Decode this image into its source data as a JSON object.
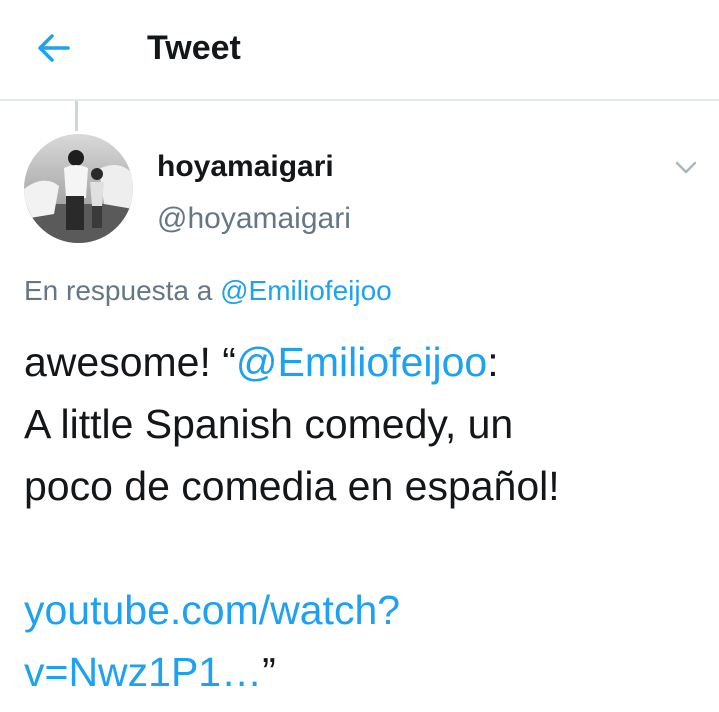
{
  "header": {
    "title": "Tweet",
    "back_icon": "arrow-left-icon",
    "accent_color": "#1da1f2"
  },
  "tweet": {
    "display_name": "hoyamaigari",
    "handle": "@hoyamaigari",
    "menu_icon": "chevron-down-icon",
    "reply_prefix": "En respuesta a",
    "reply_to": "@Emiliofeijoo",
    "text": {
      "line1_before": "awesome! “",
      "line1_mention": "@Emiliofeijoo",
      "line1_after": ":",
      "line2": "A little Spanish comedy, un",
      "line3": "poco de comedia en español!",
      "link_line1": "youtube.com/watch?",
      "link_line2": "v=Nwz1P1…",
      "closing_quote": "”"
    }
  }
}
